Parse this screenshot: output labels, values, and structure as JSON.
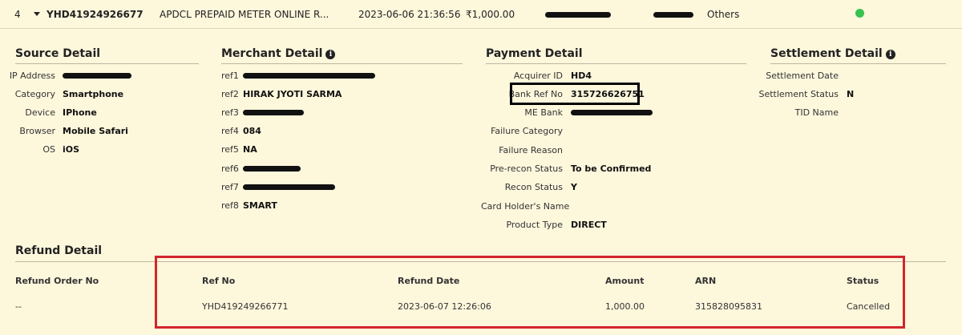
{
  "row": {
    "index": "4",
    "order_id": "YHD41924926677",
    "merchant": "APDCL PREPAID METER ONLINE R...",
    "datetime": "2023-06-06 21:36:56",
    "amount": "₹1,000.00",
    "category": "Others",
    "status_color": "#38c24f"
  },
  "source": {
    "title": "Source Detail",
    "ip_label": "IP Address",
    "category_label": "Category",
    "category_value": "Smartphone",
    "device_label": "Device",
    "device_value": "IPhone",
    "browser_label": "Browser",
    "browser_value": "Mobile Safari",
    "os_label": "OS",
    "os_value": "iOS"
  },
  "merchant": {
    "title": "Merchant Detail",
    "ref1_label": "ref1",
    "ref2_label": "ref2",
    "ref2_value": "HIRAK JYOTI SARMA",
    "ref3_label": "ref3",
    "ref4_label": "ref4",
    "ref4_value": "084",
    "ref5_label": "ref5",
    "ref5_value": "NA",
    "ref6_label": "ref6",
    "ref7_label": "ref7",
    "ref8_label": "ref8",
    "ref8_value": "SMART"
  },
  "payment": {
    "title": "Payment Detail",
    "acquirer_label": "Acquirer ID",
    "acquirer_value": "HD4",
    "bankref_label": "Bank Ref No",
    "bankref_value": "315726626751",
    "mebank_label": "ME Bank",
    "failcat_label": "Failure Category",
    "failreason_label": "Failure Reason",
    "prerecon_label": "Pre-recon Status",
    "prerecon_value": "To be Confirmed",
    "recon_label": "Recon Status",
    "recon_value": "Y",
    "cardholder_label": "Card Holder's Name",
    "product_label": "Product Type",
    "product_value": "DIRECT"
  },
  "settlement": {
    "title": "Settlement Detail",
    "date_label": "Settlement Date",
    "status_label": "Settlement Status",
    "status_value": "N",
    "tid_label": "TID Name"
  },
  "refund": {
    "title": "Refund Detail",
    "headers": [
      "Refund Order No",
      "Ref No",
      "Refund Date",
      "Amount",
      "ARN",
      "Status"
    ],
    "row": [
      "--",
      "YHD419249266771",
      "2023-06-07 12:26:06",
      "1,000.00",
      "315828095831",
      "Cancelled"
    ]
  },
  "icons": {
    "info": "info-icon",
    "expand": "chevron-down-icon",
    "status": "status-dot-icon"
  },
  "colors": {
    "background": "#fdf7dc",
    "highlight_box": "#000000",
    "refund_box": "#d3262c"
  }
}
